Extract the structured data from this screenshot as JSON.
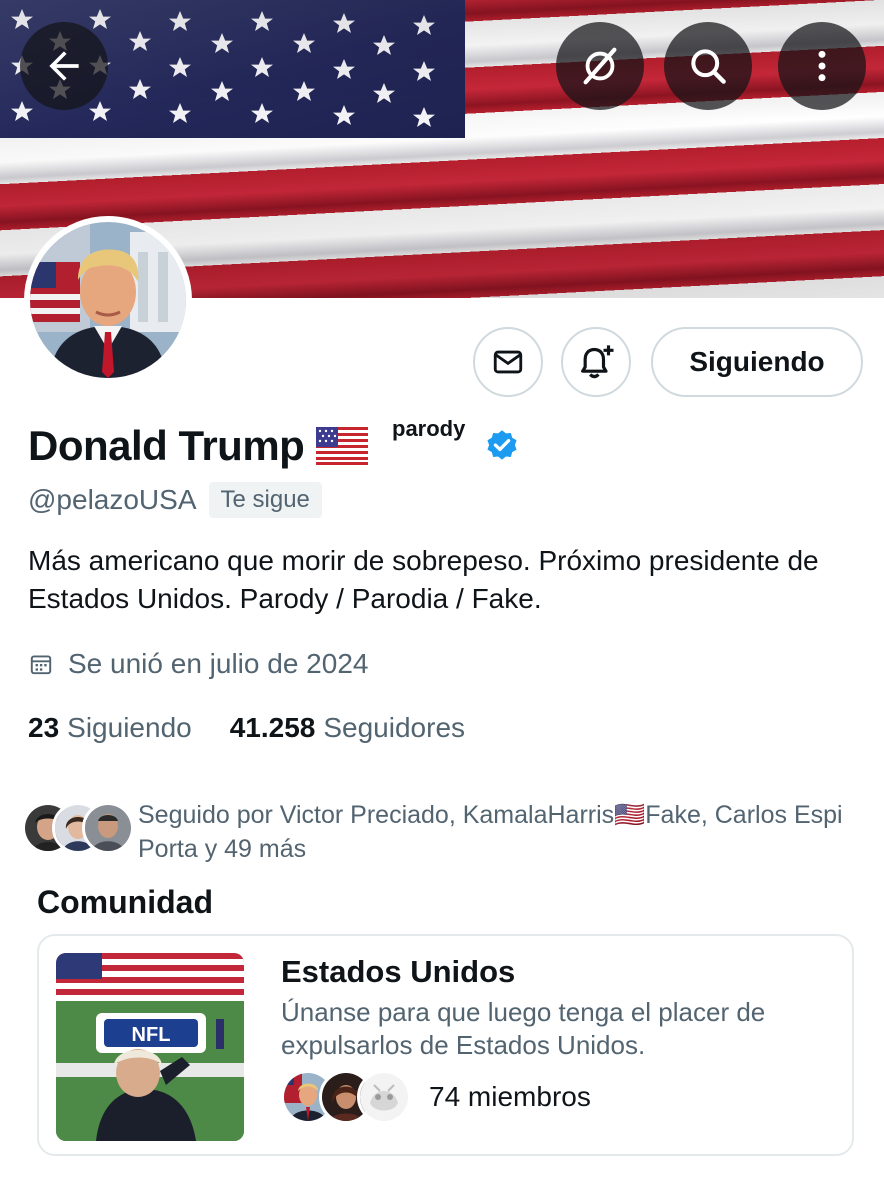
{
  "header": {
    "back_icon": "arrow-left-icon",
    "grok_icon": "grok-icon",
    "search_icon": "search-icon",
    "more_icon": "more-vertical-icon"
  },
  "profile": {
    "display_name": "Donald Trump",
    "name_flag": "us-flag-emoji",
    "parody_label": "parody",
    "verified": true,
    "verified_color": "#1d9bf0",
    "handle": "@pelazoUSA",
    "follows_you": "Te sigue",
    "bio": "Más americano que morir de sobrepeso. Próximo presidente de Estados Unidos. Parody / Parodia / Fake.",
    "joined": "Se unió en julio de 2024",
    "following_count": "23",
    "following_label": "Siguiendo",
    "followers_count": "41.258",
    "followers_label": "Seguidores"
  },
  "actions": {
    "message_icon": "mail-icon",
    "notify_icon": "bell-plus-icon",
    "follow_state_label": "Siguiendo"
  },
  "followed_by": {
    "text": "Seguido por Victor Preciado, KamalaHarris🇺🇸Fake, Carlos Espi Porta y 49 más"
  },
  "community": {
    "section_title": "Comunidad",
    "name": "Estados Unidos",
    "description": "Únanse para que luego tenga el placer de expulsarlos de Estados Unidos.",
    "members": "74 miembros"
  }
}
